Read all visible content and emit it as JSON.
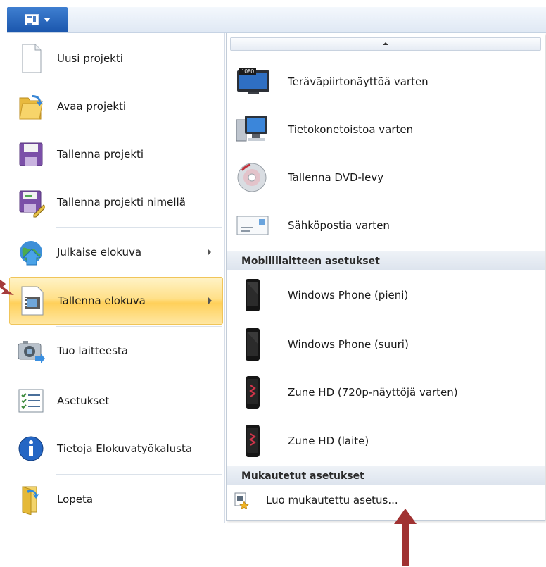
{
  "colors": {
    "accent": "#1b56ad",
    "highlight": "#ffd05a",
    "annotation_arrow": "#a03232"
  },
  "app_button": {
    "icon": "document-menu-icon"
  },
  "left_menu": {
    "items": [
      {
        "label": "Uusi projekti",
        "icon": "new-document-icon"
      },
      {
        "label": "Avaa projekti",
        "icon": "open-folder-icon"
      },
      {
        "label": "Tallenna projekti",
        "icon": "save-disk-icon"
      },
      {
        "label": "Tallenna projekti nimellä",
        "icon": "save-as-icon"
      },
      {
        "label": "Julkaise elokuva",
        "icon": "globe-publish-icon",
        "submenu": true
      },
      {
        "label": "Tallenna elokuva",
        "icon": "film-save-icon",
        "submenu": true,
        "active": true
      },
      {
        "label": "Tuo laitteesta",
        "icon": "camera-import-icon"
      },
      {
        "label": "Asetukset",
        "icon": "options-list-icon"
      },
      {
        "label": "Tietoja Elokuvatyökalusta",
        "icon": "info-icon"
      },
      {
        "label": "Lopeta",
        "icon": "exit-icon"
      }
    ]
  },
  "right_menu": {
    "items": [
      {
        "label": "Teräväpiirtonäyttöä varten",
        "icon": "hd-monitor-icon",
        "badge": "1080"
      },
      {
        "label": "Tietokonetoistoa varten",
        "icon": "computer-icon"
      },
      {
        "label": "Tallenna DVD-levy",
        "icon": "dvd-icon"
      },
      {
        "label": "Sähköpostia varten",
        "icon": "email-icon"
      }
    ],
    "section_mobile": "Mobiililaitteen asetukset",
    "mobile_items": [
      {
        "label": "Windows Phone (pieni)",
        "icon": "phone-icon"
      },
      {
        "label": "Windows Phone (suuri)",
        "icon": "phone-icon"
      },
      {
        "label": "Zune HD (720p-näyttöjä varten)",
        "icon": "zune-icon"
      },
      {
        "label": "Zune HD (laite)",
        "icon": "zune-icon"
      }
    ],
    "section_custom": "Mukautetut asetukset",
    "custom_items": [
      {
        "label": "Luo mukautettu asetus...",
        "icon": "custom-setting-icon"
      }
    ]
  }
}
